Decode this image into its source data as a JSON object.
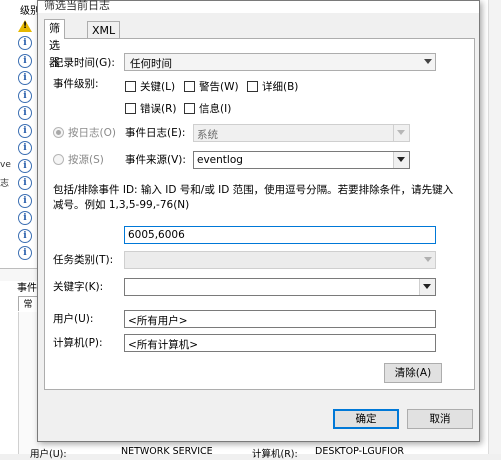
{
  "background": {
    "col_header": "级别",
    "side_text": [
      "ve",
      "志"
    ],
    "bottom_label": "事件",
    "bottom_tab": "常",
    "status_row": {
      "user_label": "用户(U):",
      "user_value": "NETWORK SERVICE",
      "computer_label": "计算机(R):",
      "computer_value": "DESKTOP-LGUFIOR"
    }
  },
  "dialog": {
    "title": "筛选当前日志",
    "tabs": [
      "筛选器",
      "XML"
    ],
    "logged_label": "记录时间(G):",
    "logged_value": "任何时间",
    "level_label": "事件级别:",
    "levels": [
      "关键(L)",
      "警告(W)",
      "详细(B)",
      "错误(R)",
      "信息(I)"
    ],
    "by_log_label": "按日志(O)",
    "event_logs_label": "事件日志(E):",
    "event_logs_value": "系统",
    "by_source_label": "按源(S)",
    "event_sources_label": "事件来源(V):",
    "event_sources_value": "eventlog",
    "description_line1": "包括/排除事件 ID: 输入 ID 号和/或 ID 范围，使用逗号分隔。若要排除条件，请先键入",
    "description_line2": "减号。例如 1,3,5-99,-76(N)",
    "event_id_value": "6005,6006",
    "task_category_label": "任务类别(T):",
    "keywords_label": "关键字(K):",
    "user_label": "用户(U):",
    "user_value": "<所有用户>",
    "computer_label": "计算机(P):",
    "computer_value": "<所有计算机>",
    "clear_button": "清除(A)",
    "ok_button": "确定",
    "cancel_button": "取消"
  }
}
